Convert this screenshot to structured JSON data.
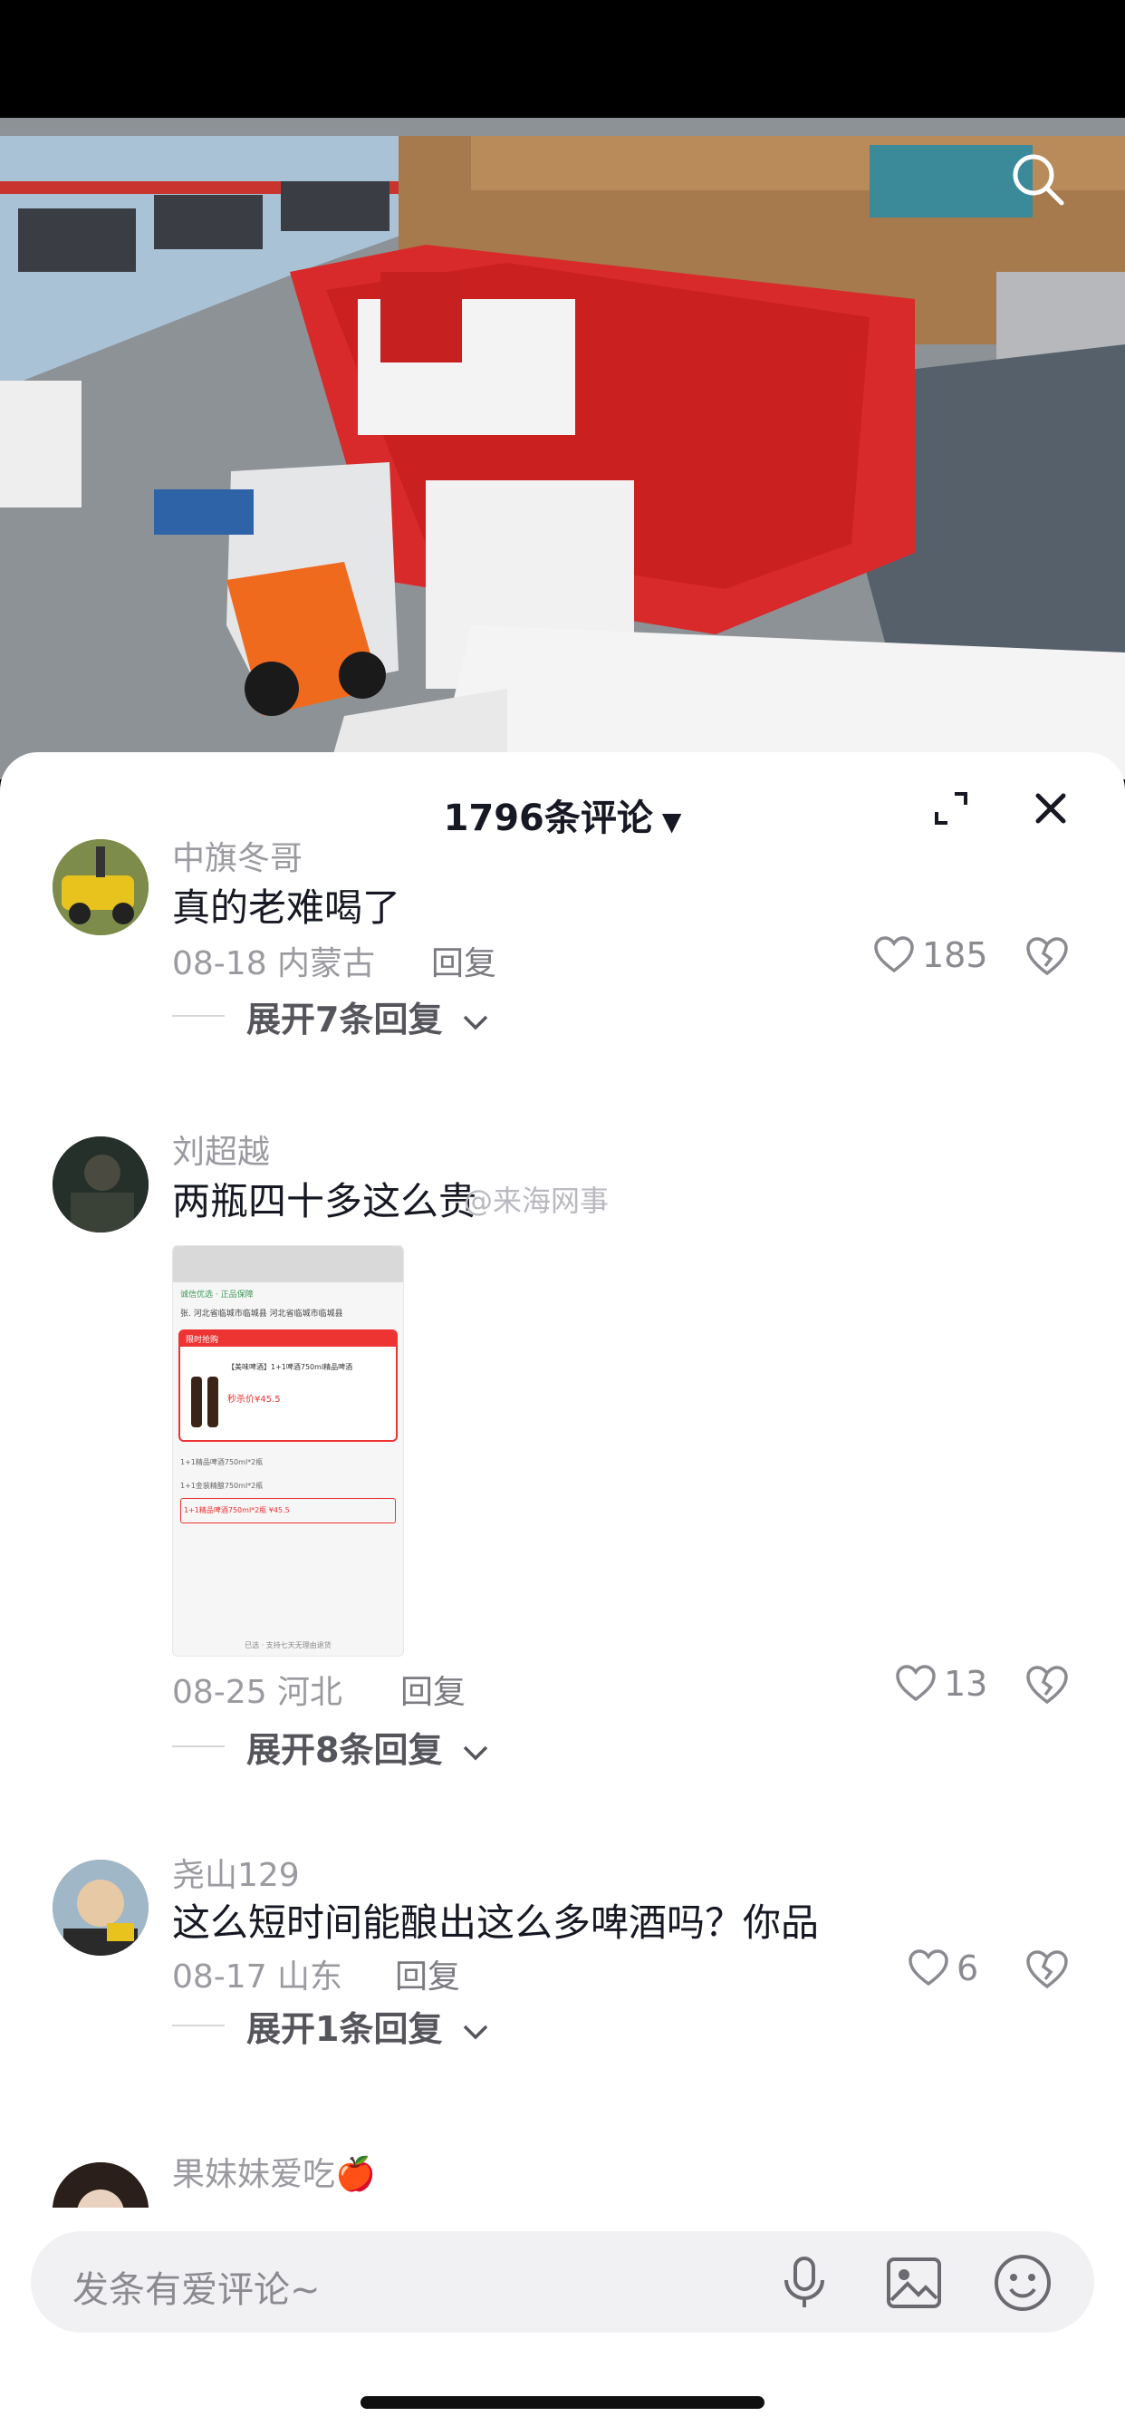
{
  "header": {
    "title": "1796条评论",
    "caret": "▼"
  },
  "comments": [
    {
      "user": "中旗冬哥",
      "text": "真的老难喝了",
      "date_loc": "08-18 内蒙古",
      "reply_label": "回复",
      "likes": "185",
      "expand": "展开7条回复"
    },
    {
      "user": "刘超越",
      "text": "两瓶四十多这么贵",
      "date_loc": "08-25 河北",
      "reply_label": "回复",
      "likes": "13",
      "expand": "展开8条回复",
      "screenshot": {
        "shop_line": "诚信优选 · 正品保障",
        "address": "张. 河北省临城市临城县 河北省临城市临城县",
        "badge": "限时抢购",
        "product": "【美味啤酒】1+1啤酒750ml精品啤酒",
        "price": "秒杀价¥45.5",
        "options": [
          "1+1精品啤酒750ml*2瓶",
          "1+1金装精酿750ml*2瓶",
          "1+1精品啤酒750ml*2瓶 ¥45.5"
        ],
        "footer": "已选 · 支持七天无理由退货"
      }
    },
    {
      "user": "尧山129",
      "text": "这么短时间能酿出这么多啤酒吗？你品",
      "date_loc": "08-17 山东",
      "reply_label": "回复",
      "likes": "6",
      "expand": "展开1条回复"
    },
    {
      "user": "果妹妹爱吃🍎",
      "text": "",
      "date_loc": "",
      "reply_label": "",
      "likes": "",
      "expand": ""
    }
  ],
  "watermark": "@来海网事",
  "input": {
    "placeholder": "发条有爱评论~"
  },
  "colors": {
    "sheet_bg": "#ffffff",
    "text_primary": "#161823",
    "text_secondary": "#9a9aa0",
    "input_bg": "#f1f1f3"
  },
  "icons": [
    "search-icon",
    "expand-icon",
    "close-icon",
    "heart-icon",
    "dislike-heart-icon",
    "chevron-down-icon",
    "microphone-icon",
    "image-icon",
    "emoji-icon"
  ]
}
